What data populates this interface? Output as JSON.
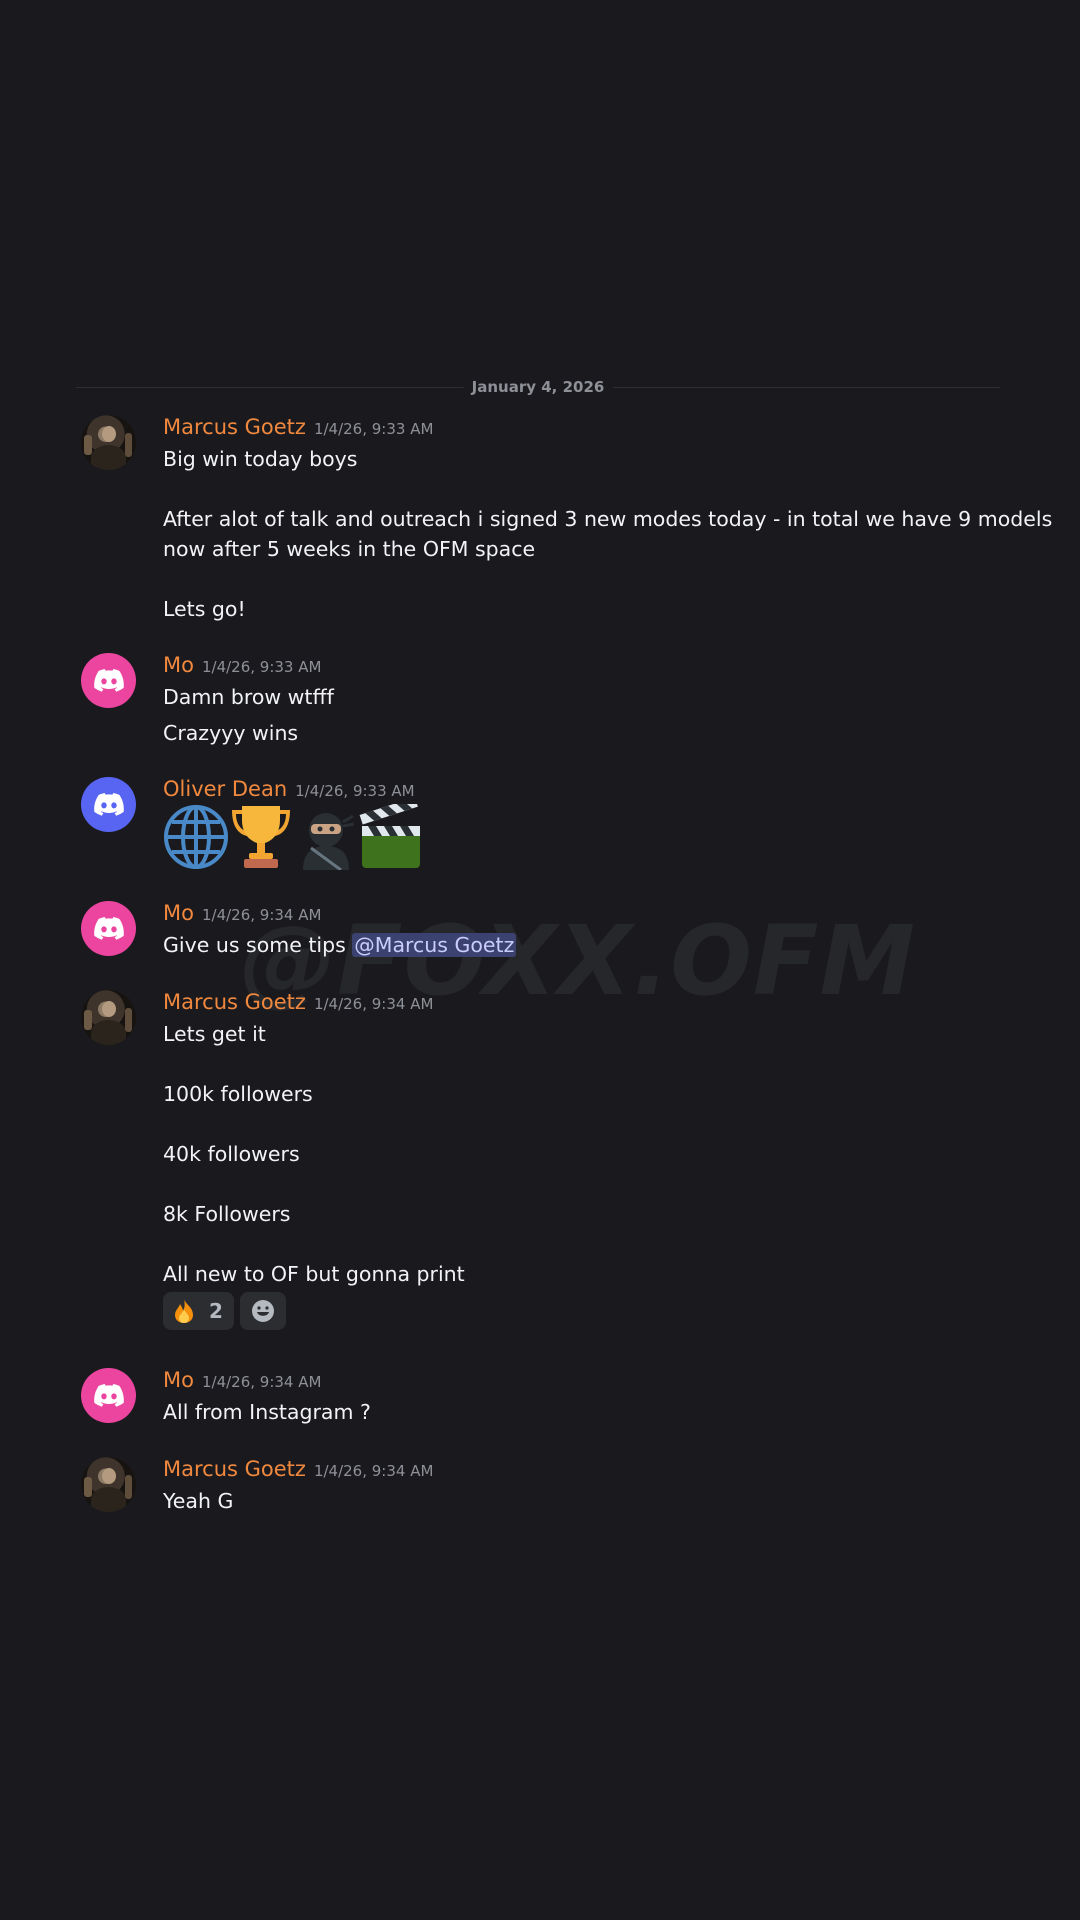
{
  "divider": {
    "date": "January 4, 2026"
  },
  "watermark": "@FOXX.OFM",
  "colors": {
    "background": "#1a1a1e",
    "username": "#f0883e",
    "mention_bg": "#3c4270"
  },
  "messages": [
    {
      "author": "Marcus Goetz",
      "time": "1/4/26, 9:33 AM",
      "avatar": "photo",
      "lines": [
        "Big win today boys",
        "After alot of talk and outreach i signed 3 new modes today - in total we have 9 models",
        "now after 5 weeks in the OFM space",
        "Lets go!"
      ]
    },
    {
      "author": "Mo",
      "time": "1/4/26, 9:33 AM",
      "avatar": "discord-pink-icon",
      "lines": [
        "Damn brow wtfff",
        "Crazyyy wins"
      ]
    },
    {
      "author": "Oliver Dean",
      "time": "1/4/26, 9:33 AM",
      "avatar": "discord-blurple-icon",
      "emojis": [
        "globe-icon",
        "trophy-icon",
        "ninja-icon",
        "clapper-board-icon"
      ]
    },
    {
      "author": "Mo",
      "time": "1/4/26, 9:34 AM",
      "avatar": "discord-pink-icon",
      "text": "Give us some tips ",
      "mention": "@Marcus Goetz"
    },
    {
      "author": "Marcus Goetz",
      "time": "1/4/26, 9:34 AM",
      "avatar": "photo",
      "lines": [
        "Lets get it",
        "100k followers",
        "40k followers",
        "8k Followers",
        "All new to OF but gonna print"
      ],
      "reactions": [
        {
          "emoji": "fire-icon",
          "count": "2"
        },
        {
          "emoji": "add-reaction-icon"
        }
      ]
    },
    {
      "author": "Mo",
      "time": "1/4/26, 9:34 AM",
      "avatar": "discord-pink-icon",
      "lines": [
        "All from Instagram ?"
      ]
    },
    {
      "author": "Marcus Goetz",
      "time": "1/4/26, 9:34 AM",
      "avatar": "photo",
      "lines": [
        "Yeah G"
      ]
    }
  ]
}
